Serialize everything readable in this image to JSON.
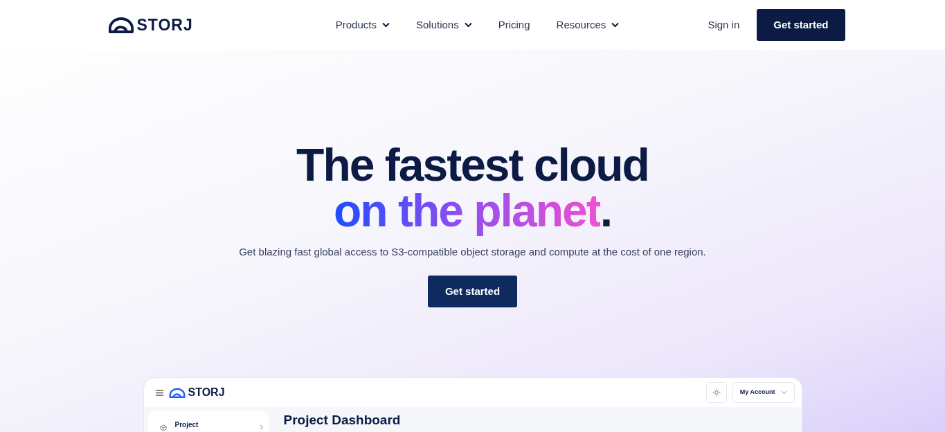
{
  "header": {
    "logo": "STORJ",
    "nav": [
      {
        "label": "Products",
        "dropdown": true
      },
      {
        "label": "Solutions",
        "dropdown": true
      },
      {
        "label": "Pricing",
        "dropdown": false
      },
      {
        "label": "Resources",
        "dropdown": true
      }
    ],
    "sign_in": "Sign in",
    "cta": "Get started"
  },
  "hero": {
    "title_line1": "The fastest cloud",
    "title_line2": "on the planet",
    "title_end": ".",
    "subtitle": "Get blazing fast global access to S3-compatible object storage and compute at the cost of one region.",
    "cta": "Get started"
  },
  "dashboard": {
    "logo": "STORJ",
    "account": "My Account",
    "sidebar_item": "Project",
    "heading": "Project Dashboard"
  }
}
